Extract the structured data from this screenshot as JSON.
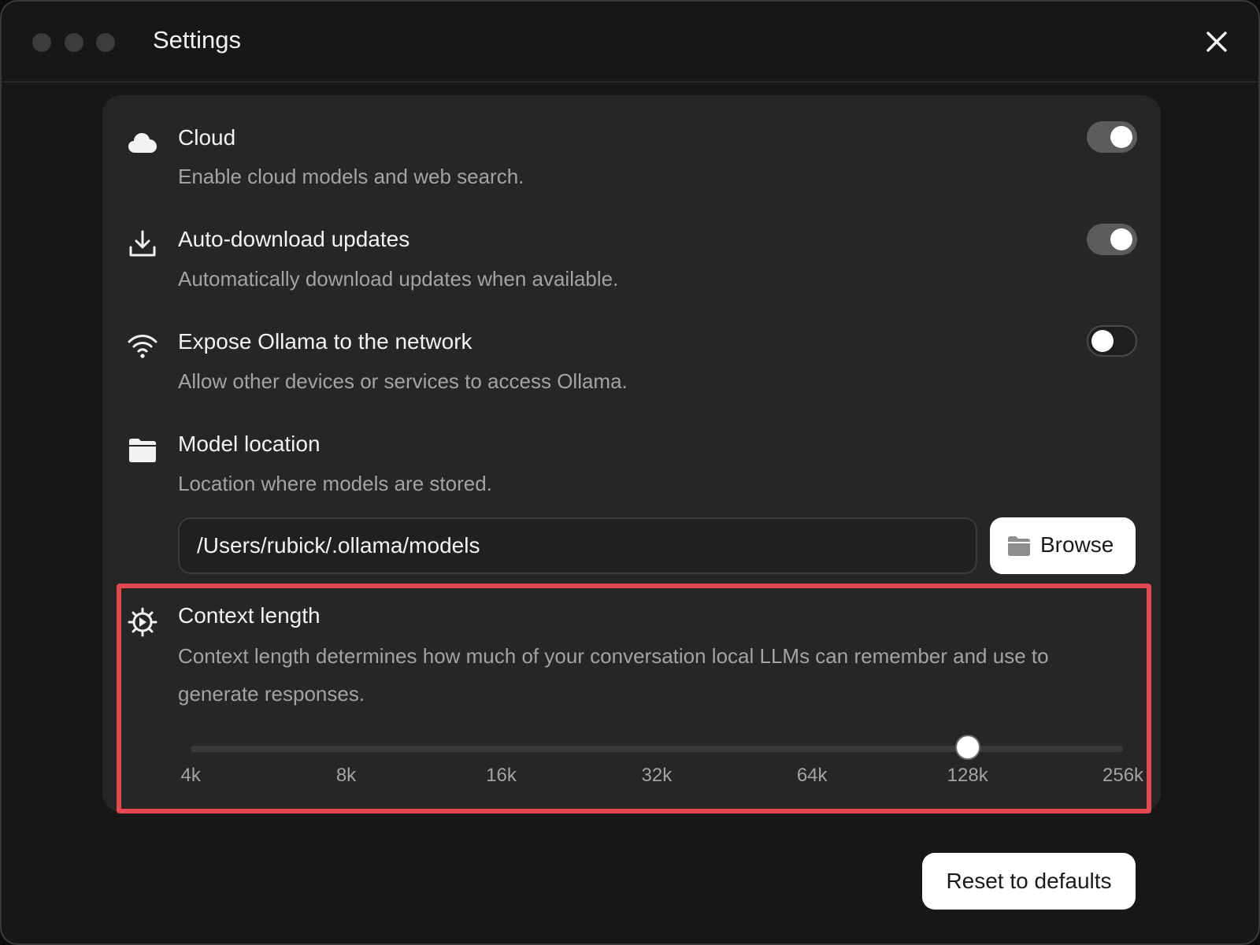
{
  "window": {
    "title": "Settings"
  },
  "settings": [
    {
      "id": "cloud",
      "icon": "cloud-icon",
      "title": "Cloud",
      "description": "Enable cloud models and web search.",
      "enabled": true
    },
    {
      "id": "auto-download",
      "icon": "download-icon",
      "title": "Auto-download updates",
      "description": "Automatically download updates when available.",
      "enabled": true
    },
    {
      "id": "expose-network",
      "icon": "wifi-icon",
      "title": "Expose Ollama to the network",
      "description": "Allow other devices or services to access Ollama.",
      "enabled": false
    }
  ],
  "model_location": {
    "icon": "folder-icon",
    "title": "Model location",
    "description": "Location where models are stored.",
    "path": "/Users/rubick/.ollama/models",
    "browse_label": "Browse"
  },
  "context_length": {
    "icon": "gear-icon",
    "title": "Context length",
    "description": "Context length determines how much of your conversation local LLMs can remember and use to generate responses.",
    "ticks": [
      "4k",
      "8k",
      "16k",
      "32k",
      "64k",
      "128k",
      "256k"
    ],
    "selected": "128k"
  },
  "footer": {
    "reset_label": "Reset to defaults"
  },
  "colors": {
    "highlight": "#e5484d",
    "panel": "#262626",
    "window": "#171717"
  }
}
